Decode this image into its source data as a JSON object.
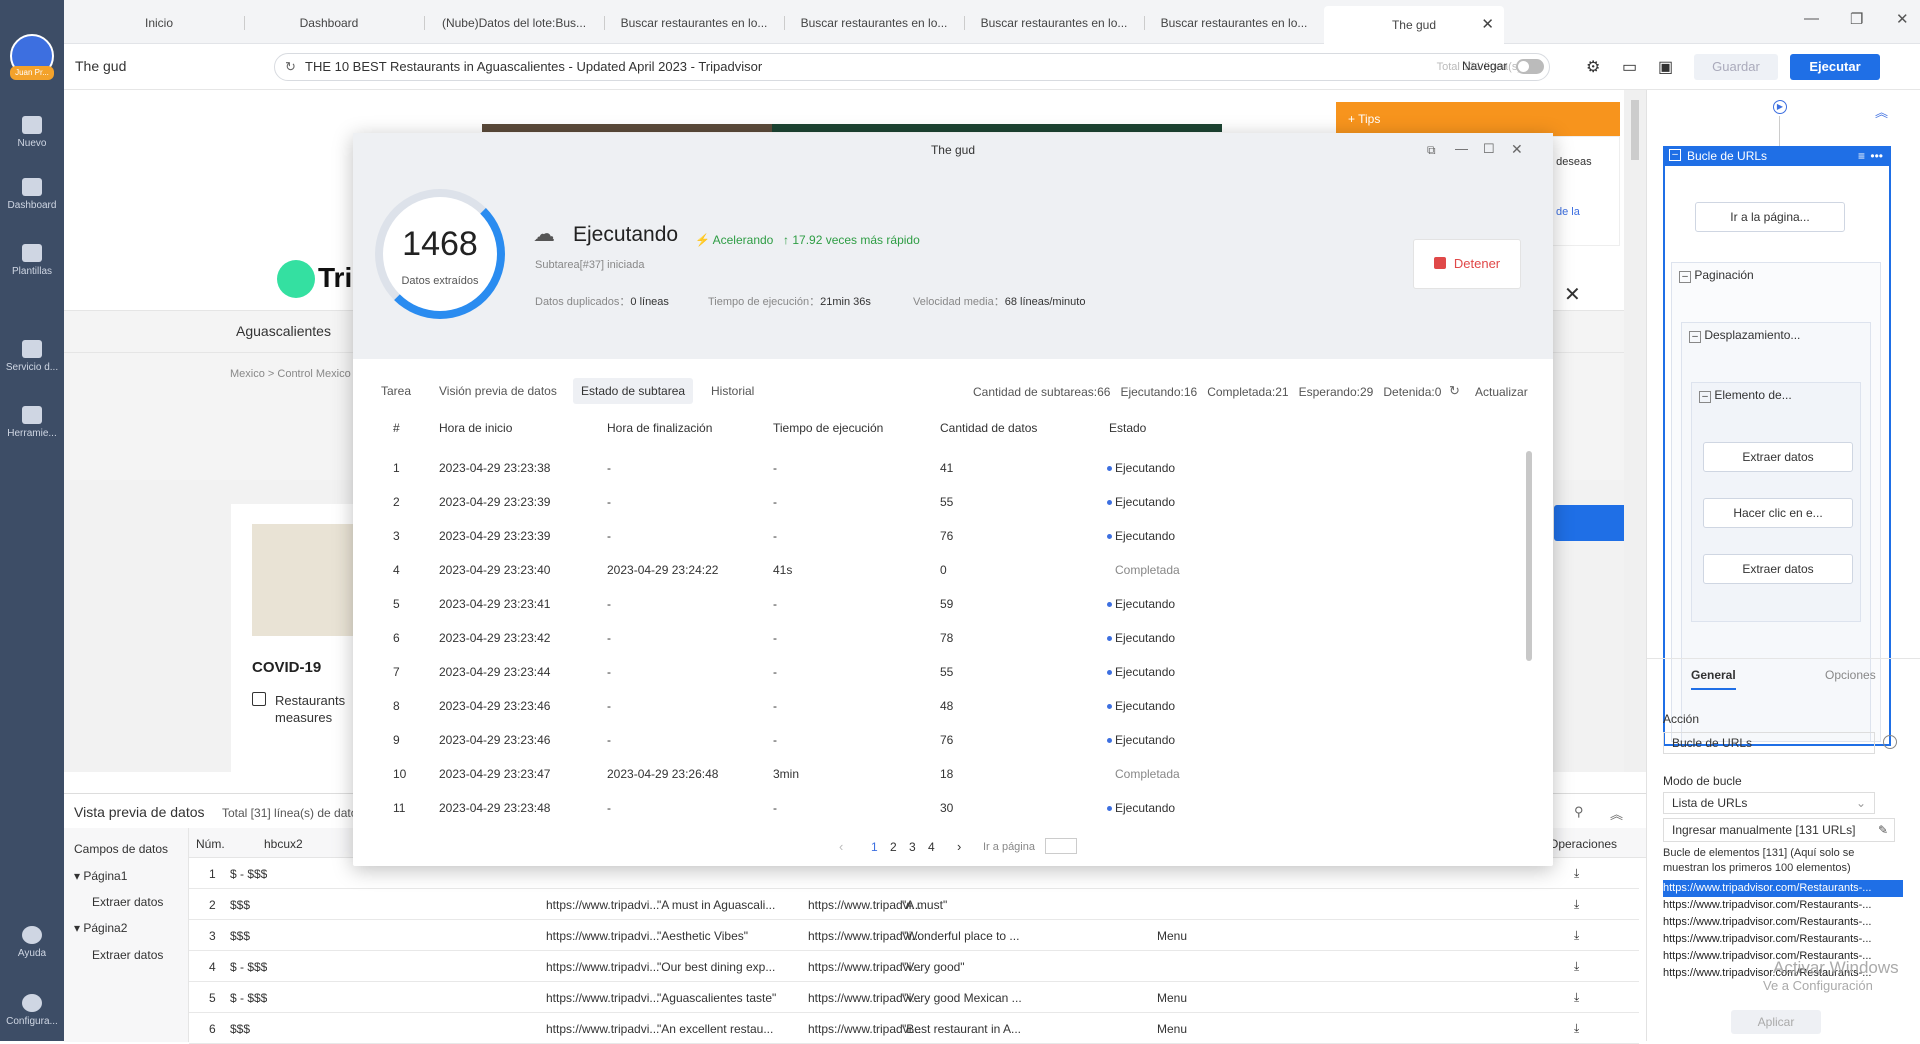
{
  "sidebar": {
    "user_tag": "Juan Pr...",
    "items": [
      "Nuevo",
      "Dashboard",
      "Plantillas",
      "Servicio d...",
      "Herramie..."
    ],
    "bottom": [
      "Ayuda",
      "Configura..."
    ]
  },
  "tabs": [
    "Inicio",
    "Dashboard",
    "(Nube)Datos del lote:Bus...",
    "Buscar restaurantes en lo...",
    "Buscar restaurantes en lo...",
    "Buscar restaurantes en lo...",
    "Buscar restaurantes en lo...",
    "The gud"
  ],
  "toolbar": {
    "task_name": "The gud",
    "url_text": "THE 10 BEST Restaurants in Aguascalientes - Updated April 2023 - Tripadvisor",
    "total": "Total 131 línea(s)",
    "navigate": "Navegar",
    "save": "Guardar",
    "run": "Ejecutar"
  },
  "browser": {
    "tips": "Tips",
    "tips_text1": "e deseas",
    "tips_text2": "de la",
    "city": "Aguascalientes",
    "breadcrumb": "Mexico > Control Mexico",
    "covid": "COVID-19",
    "restaurants_line1": "Restaurants",
    "restaurants_line2": "measures"
  },
  "modal": {
    "title": "The gud",
    "count": "1468",
    "count_label": "Datos extraídos",
    "status": "Ejecutando",
    "accelerating": "Acelerando",
    "faster": "17.92 veces más rápido",
    "subtask": "Subtarea[#37] iniciada",
    "dup_label": "Datos duplicados：",
    "dup_value": "0 líneas",
    "time_label": "Tiempo de ejecución：",
    "time_value": "21min 36s",
    "speed_label": "Velocidad media：",
    "speed_value": "68 líneas/minuto",
    "stop": "Detener",
    "tabs": [
      "Tarea",
      "Visión previa de datos",
      "Estado de subtarea",
      "Historial"
    ],
    "stats": {
      "total": "Cantidad de subtareas:66",
      "running": "Ejecutando:16",
      "completed": "Completada:21",
      "waiting": "Esperando:29",
      "stopped": "Detenida:0",
      "refresh": "Actualizar"
    },
    "headers": [
      "#",
      "Hora de inicio",
      "Hora de finalización",
      "Tiempo de ejecución",
      "Cantidad de datos",
      "Estado"
    ],
    "rows": [
      [
        "1",
        "2023-04-29 23:23:38",
        "-",
        "-",
        "41",
        "Ejecutando"
      ],
      [
        "2",
        "2023-04-29 23:23:39",
        "-",
        "-",
        "55",
        "Ejecutando"
      ],
      [
        "3",
        "2023-04-29 23:23:39",
        "-",
        "-",
        "76",
        "Ejecutando"
      ],
      [
        "4",
        "2023-04-29 23:23:40",
        "2023-04-29 23:24:22",
        "41s",
        "0",
        "Completada"
      ],
      [
        "5",
        "2023-04-29 23:23:41",
        "-",
        "-",
        "59",
        "Ejecutando"
      ],
      [
        "6",
        "2023-04-29 23:23:42",
        "-",
        "-",
        "78",
        "Ejecutando"
      ],
      [
        "7",
        "2023-04-29 23:23:44",
        "-",
        "-",
        "55",
        "Ejecutando"
      ],
      [
        "8",
        "2023-04-29 23:23:46",
        "-",
        "-",
        "48",
        "Ejecutando"
      ],
      [
        "9",
        "2023-04-29 23:23:46",
        "-",
        "-",
        "76",
        "Ejecutando"
      ],
      [
        "10",
        "2023-04-29 23:23:47",
        "2023-04-29 23:26:48",
        "3min",
        "18",
        "Completada"
      ],
      [
        "11",
        "2023-04-29 23:23:48",
        "-",
        "-",
        "30",
        "Ejecutando"
      ]
    ],
    "pages": [
      "1",
      "2",
      "3",
      "4"
    ],
    "goto": "Ir a página"
  },
  "bottom": {
    "title": "Vista previa de datos",
    "total": "Total [31] línea(s) de dato",
    "fields": "Campos de datos",
    "tree": [
      "Página1",
      "Extraer datos",
      "Página2",
      "Extraer datos"
    ],
    "col_num": "Núm.",
    "col1": "hbcux2",
    "ops": "Operaciones",
    "rows": [
      [
        "1",
        "$ - $$$",
        "",
        "",
        "",
        "",
        ""
      ],
      [
        "2",
        "$$$",
        "https://www.tripadvi...",
        "\"A must in Aguascali...",
        "https://www.tripadvi...",
        "\"A must\"",
        ""
      ],
      [
        "3",
        "$$$",
        "https://www.tripadvi...",
        "\"Aesthetic Vibes\"",
        "https://www.tripadvi...",
        "\"Wonderful place to ...",
        "Menu"
      ],
      [
        "4",
        "$ - $$$",
        "https://www.tripadvi...",
        "\"Our best dining exp...",
        "https://www.tripadvi...",
        "\"Very good\"",
        ""
      ],
      [
        "5",
        "$ - $$$",
        "https://www.tripadvi...",
        "\"Aguascalientes taste\"",
        "https://www.tripadvi...",
        "\"Very good Mexican ...",
        "Menu"
      ],
      [
        "6",
        "$$$",
        "https://www.tripadvi...",
        "\"An excellent restau...",
        "https://www.tripadvi...",
        "\"Best restaurant in A...",
        "Menu"
      ]
    ]
  },
  "right": {
    "loop": "Bucle de URLs",
    "nodes": [
      "Ir a la página...",
      "Paginación",
      "Desplazamiento...",
      "Elemento de...",
      "Extraer datos",
      "Hacer clic en e...",
      "Extraer datos"
    ],
    "tabs": [
      "General",
      "Opciones"
    ],
    "action_label": "Acción",
    "action_value": "Bucle de URLs",
    "mode_label": "Modo de bucle",
    "mode_value": "Lista de URLs",
    "manual": "Ingresar manualmente [131 URLs]",
    "loop_info": "Bucle de elementos [131] (Aquí solo se muestran los primeros 100 elementos)",
    "urls": [
      "https://www.tripadvisor.com/Restaurants-...",
      "https://www.tripadvisor.com/Restaurants-...",
      "https://www.tripadvisor.com/Restaurants-...",
      "https://www.tripadvisor.com/Restaurants-...",
      "https://www.tripadvisor.com/Restaurants-...",
      "https://www.tripadvisor.com/Restaurants-..."
    ],
    "apply": "Aplicar",
    "watermark1": "Activar Windows",
    "watermark2": "Ve a Configuración"
  }
}
